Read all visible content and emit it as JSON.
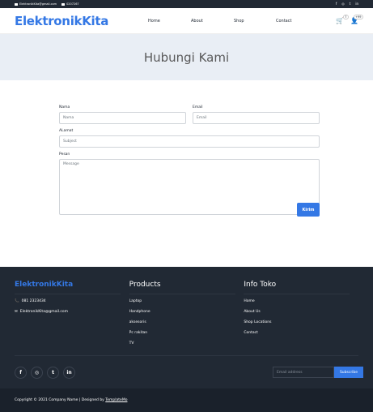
{
  "topbar": {
    "email": "ElektronikKita@gmail.com",
    "phone": "0207267",
    "socials": [
      "f",
      "◎",
      "t",
      "in"
    ]
  },
  "navbar": {
    "brand": "ElektronikKita",
    "links": [
      "Home",
      "About",
      "Shop",
      "Contact"
    ],
    "cart_count": "7",
    "user_count": "+99"
  },
  "hero": {
    "title": "Hubungi Kami"
  },
  "form": {
    "name_label": "Nama",
    "name_placeholder": "Nama",
    "email_label": "Email",
    "email_placeholder": "Email",
    "address_label": "ALamat",
    "address_placeholder": "Subject",
    "message_label": "Pesan",
    "message_placeholder": "Message",
    "submit_label": "Kirim"
  },
  "footer": {
    "brand": "ElektronikKita",
    "phone": "081 2323434",
    "email": "ElektronikKita@gmail.com",
    "products_title": "Products",
    "products": [
      "Laptop",
      "Handphone",
      "aksesoris",
      "Pc rakitan",
      "TV"
    ],
    "info_title": "Info Toko",
    "info": [
      "Home",
      "About Us",
      "Shop Locations",
      "Contact"
    ],
    "socials": [
      "f",
      "◎",
      "t",
      "in"
    ],
    "subscribe_placeholder": "Email address",
    "subscribe_button": "Subscribe",
    "copyright": "Copyright © 2021 Company Name | Designed by ",
    "designer": "TemplateMo"
  },
  "colors": {
    "accent": "#3478e5",
    "dark": "#212934",
    "hero_bg": "#e9eef5"
  }
}
